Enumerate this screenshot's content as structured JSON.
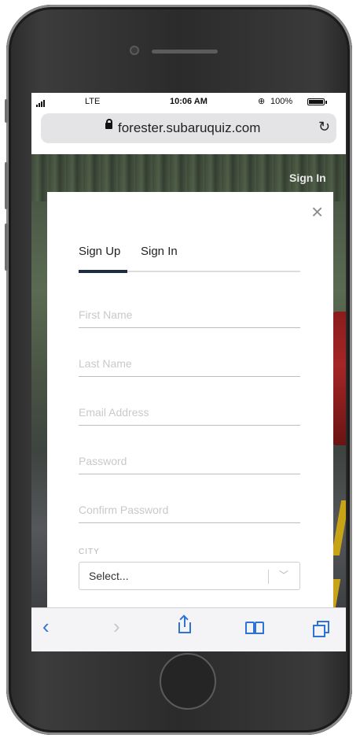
{
  "status_bar": {
    "carrier": "LTE",
    "time": "10:06 AM",
    "battery": "100%"
  },
  "browser": {
    "url": "forester.subaruquiz.com"
  },
  "site": {
    "nav_signin": "Sign In"
  },
  "modal": {
    "close": "×",
    "tabs": [
      {
        "label": "Sign Up",
        "active": true
      },
      {
        "label": "Sign In",
        "active": false
      }
    ],
    "fields": {
      "first_name": "First Name",
      "last_name": "Last Name",
      "email": "Email Address",
      "password": "Password",
      "confirm_password": "Confirm Password"
    },
    "city": {
      "label": "CITY",
      "value": "Select..."
    }
  },
  "colors": {
    "accent": "#1d2b45",
    "safari_blue": "#2f73d6"
  },
  "icons": [
    "lock-icon",
    "reload-icon",
    "close-icon",
    "chevron-down-icon",
    "back-icon",
    "forward-icon",
    "share-icon",
    "bookmarks-icon",
    "tabs-icon"
  ]
}
